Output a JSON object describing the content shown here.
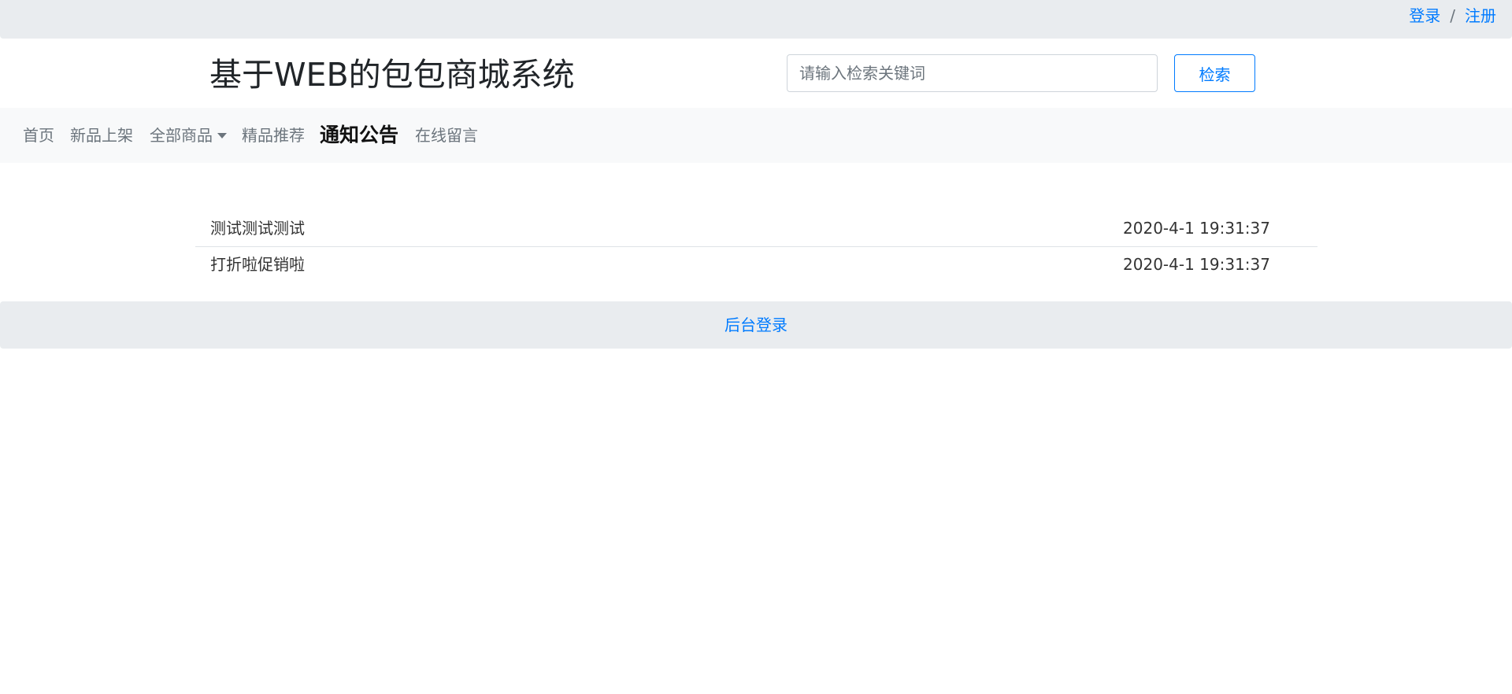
{
  "topbar": {
    "login": "登录",
    "separator": "/",
    "register": "注册"
  },
  "header": {
    "title": "基于WEB的包包商城系统",
    "search_placeholder": "请输入检索关键词",
    "search_value": "",
    "search_button": "检索"
  },
  "nav": {
    "items": [
      {
        "label": "首页"
      },
      {
        "label": "新品上架"
      },
      {
        "label": "全部商品"
      },
      {
        "label": "精品推荐"
      },
      {
        "label": "通知公告"
      },
      {
        "label": "在线留言"
      }
    ],
    "active": "通知公告"
  },
  "notices": [
    {
      "title": "测试测试测试",
      "time": "2020-4-1 19:31:37"
    },
    {
      "title": "打折啦促销啦",
      "time": "2020-4-1 19:31:37"
    }
  ],
  "footer": {
    "admin_login": "后台登录"
  },
  "colors": {
    "link": "#007bff",
    "topbar_bg": "#e9ecef",
    "nav_bg": "#f8f9fa",
    "nav_text": "#6c757d"
  }
}
